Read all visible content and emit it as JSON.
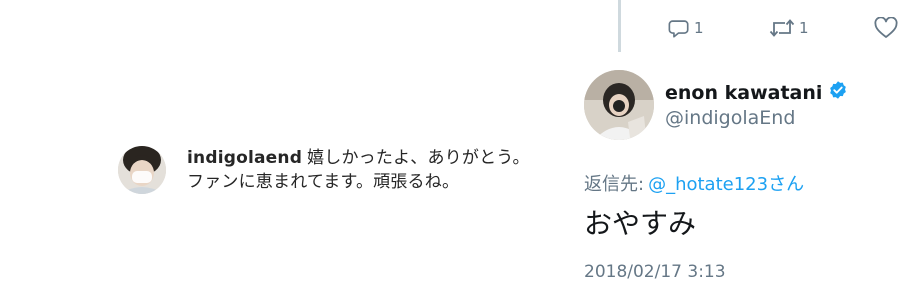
{
  "comment": {
    "username": "indigolaend",
    "line1": "嬉しかったよ、ありがとう。",
    "line2": "ファンに恵まれてます。頑張るね。"
  },
  "tweet": {
    "display_name": "enon kawatani",
    "handle": "@indigolaEnd",
    "reply_prefix": "返信先:",
    "reply_mention": "@_hotate123さん",
    "text": "おやすみ",
    "timestamp": "2018/02/17 3:13",
    "reply_count": "1",
    "retweet_count": "1",
    "like_count": "",
    "icons": {
      "reply": "reply-icon",
      "retweet": "retweet-icon",
      "like": "heart-icon",
      "verified": "verified-badge-icon"
    },
    "colors": {
      "verified": "#1da1f2",
      "mention": "#1da1f2",
      "secondary_text": "#657786"
    }
  }
}
